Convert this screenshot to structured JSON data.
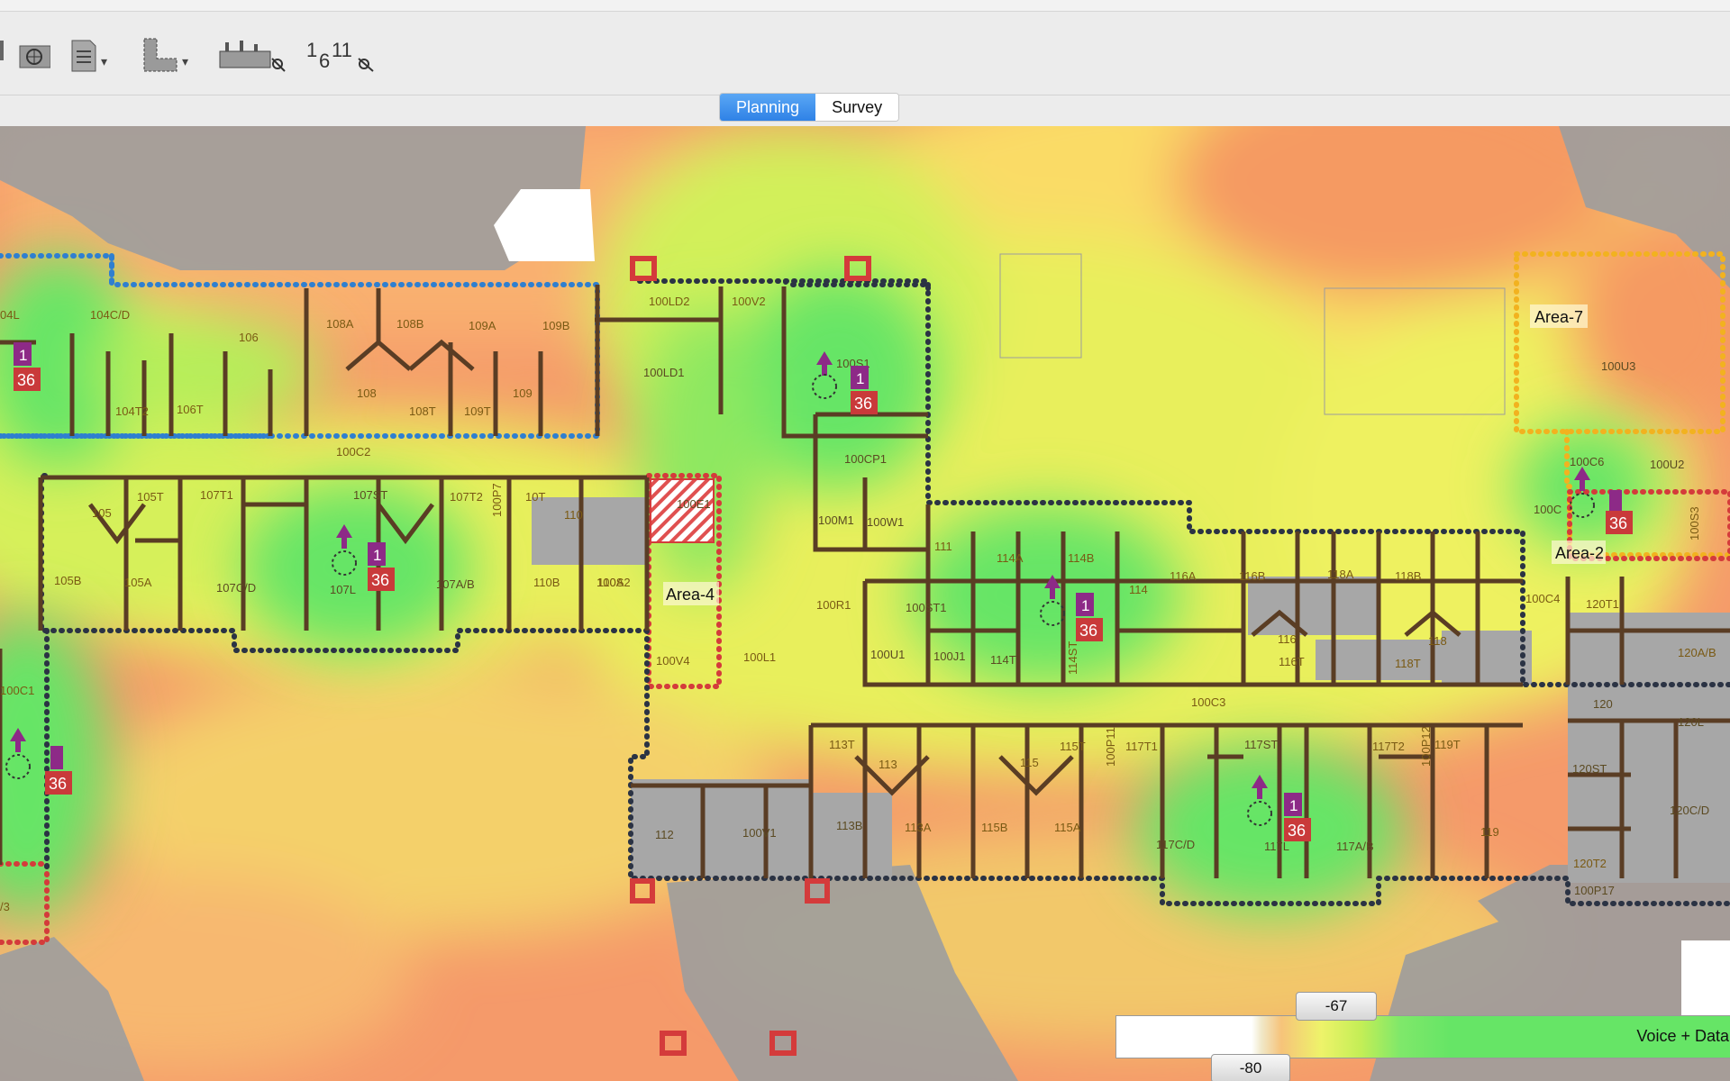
{
  "toolbar": {
    "buttons": [
      {
        "name": "zoom-floor-icon"
      },
      {
        "name": "report-icon",
        "has_menu": true
      },
      {
        "name": "wall-tool-icon",
        "has_menu": true
      },
      {
        "name": "auto-place-ap-icon"
      },
      {
        "name": "auto-channel-icon",
        "label_a": "1",
        "label_b": "6",
        "label_c": "11"
      }
    ]
  },
  "tabs": {
    "planning": "Planning",
    "survey": "Survey",
    "active": "Planning"
  },
  "areas": [
    "Area-7",
    "Area-2",
    "Area-4"
  ],
  "access_points": [
    {
      "id": "ap-104",
      "number": "1",
      "channel": "36"
    },
    {
      "id": "ap-100s1",
      "number": "1",
      "channel": "36"
    },
    {
      "id": "ap-107",
      "number": "1",
      "channel": "36"
    },
    {
      "id": "ap-114",
      "number": "1",
      "channel": "36"
    },
    {
      "id": "ap-100c1",
      "number": "",
      "channel": "36"
    },
    {
      "id": "ap-117",
      "number": "1",
      "channel": "36"
    },
    {
      "id": "ap-100c6",
      "number": "",
      "channel": "36"
    }
  ],
  "rooms": [
    "04L",
    "104C/D",
    "106",
    "108A",
    "108B",
    "109A",
    "109B",
    "100LD2",
    "100V2",
    "100S1",
    "100LD1",
    "104T2",
    "106T",
    "108",
    "108T",
    "109T",
    "109",
    "100C2",
    "105T",
    "107T1",
    "107ST",
    "107T2",
    "100P7",
    "10T",
    "110",
    "100E1",
    "105",
    "105B",
    "105A",
    "107C/D",
    "107L",
    "107A/B",
    "110B",
    "110A",
    "100S2",
    "100V4",
    "100L1",
    "100R1",
    "100CP1",
    "100M1",
    "100W1",
    "111",
    "114A",
    "114B",
    "114",
    "100ST1",
    "100U1",
    "100J1",
    "114T",
    "114ST",
    "116A",
    "116B",
    "118A",
    "118B",
    "116",
    "118",
    "116T",
    "118T",
    "100C3",
    "100C1",
    "113T",
    "113",
    "115",
    "115T",
    "100P11",
    "117T1",
    "117ST",
    "117T2",
    "100P12",
    "119T",
    "112",
    "100V1",
    "113B",
    "113A",
    "115B",
    "115A",
    "117C/D",
    "117L",
    "117A/B",
    "119",
    "100U3",
    "100C6",
    "100U2",
    "100C",
    "100S3",
    "100C4",
    "120T1",
    "120A/B",
    "120",
    "120L",
    "120ST",
    "120C/D",
    "120T2",
    "100P17",
    "/3"
  ],
  "legend": {
    "label": "Voice + Data",
    "upper_threshold": "-67",
    "lower_threshold": "-80"
  }
}
